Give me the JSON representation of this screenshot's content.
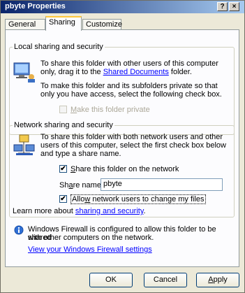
{
  "window": {
    "title": "pbyte Properties",
    "help_btn": "?",
    "close_btn": "×"
  },
  "tabs": [
    {
      "label": "General"
    },
    {
      "label": "Sharing"
    },
    {
      "label": "Customize"
    }
  ],
  "local": {
    "legend": "Local sharing and security",
    "text1_a": "To share this folder with other users of this computer",
    "text1_b_pre": "only, drag it to the ",
    "text1_link": "Shared Documents",
    "text1_b_post": " folder.",
    "text2_a": "To make this folder and its subfolders private so that",
    "text2_b": "only you have access, select the following check box.",
    "private_label_u": "M",
    "private_label_rest": "ake this folder private",
    "private_checked": false
  },
  "network": {
    "legend": "Network sharing and security",
    "text_a": "To share this folder with both network users and other",
    "text_b": "users of this computer, select the first check box below",
    "text_c": "and type a share name.",
    "share_label_u": "S",
    "share_label_rest": "hare this folder on the network",
    "share_checked_mark": "✔",
    "sharename_label_pre": "Sh",
    "sharename_label_u": "a",
    "sharename_label_post": "re name:",
    "sharename_value": "pbyte",
    "allow_label_pre": "Allo",
    "allow_label_u": "w",
    "allow_label_post": " network users to change my files",
    "allow_checked_mark": "✔"
  },
  "learn": {
    "prefix": "Learn more about ",
    "link": "sharing and security",
    "suffix": "."
  },
  "firewall": {
    "line1": "Windows Firewall is configured to allow this folder to be shared",
    "line2": "with other computers on the network.",
    "link": "View your Windows Firewall settings"
  },
  "buttons": {
    "ok": "OK",
    "cancel": "Cancel",
    "apply_u": "A",
    "apply_rest": "pply"
  },
  "colors": {
    "title_start": "#0a246a",
    "title_end": "#a6caf0",
    "dialog_bg": "#ece9d8",
    "panel_bg": "#fcfcfe",
    "link": "#0000ff"
  }
}
